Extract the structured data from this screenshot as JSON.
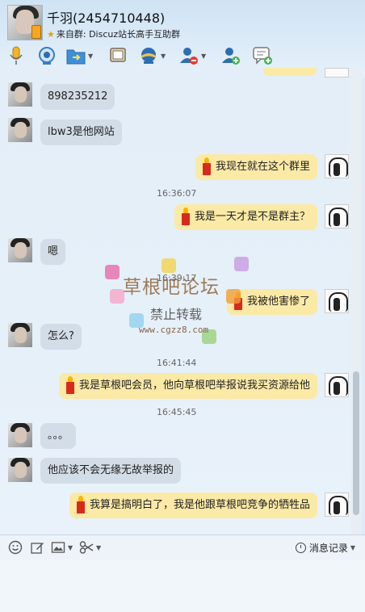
{
  "header": {
    "contact_name": "千羽(2454710448)",
    "source": "来自群: Discuz站长高手互助群"
  },
  "toolbar": {
    "icons": [
      "microphone-icon",
      "video-icon",
      "file-transfer-icon",
      "remote-desktop-icon",
      "app-icon",
      "block-user-icon",
      "add-friend-icon",
      "group-message-icon"
    ]
  },
  "messages": [
    {
      "dir": "in",
      "text": "898235212"
    },
    {
      "dir": "in",
      "text": "lbw3是他网站"
    },
    {
      "dir": "out",
      "text": "我现在就在这个群里"
    },
    {
      "time": "16:36:07"
    },
    {
      "dir": "out",
      "text": "我是一天才是不是群主？"
    },
    {
      "dir": "in",
      "text": "嗯"
    },
    {
      "time": "16:39:17"
    },
    {
      "dir": "out",
      "text": "我被他害惨了"
    },
    {
      "dir": "in",
      "text": "怎么?"
    },
    {
      "time": "16:41:44"
    },
    {
      "dir": "out",
      "text": "我是草根吧会员，他向草根吧举报说我买资源给他"
    },
    {
      "time": "16:45:45"
    },
    {
      "dir": "in",
      "text": "。。。"
    },
    {
      "dir": "in",
      "text": "他应该不会无缘无故举报的"
    },
    {
      "dir": "out",
      "text": "我算是搞明白了，我是他跟草根吧竞争的牺牲品"
    }
  ],
  "watermark": {
    "title": "草根吧论坛",
    "subtitle": "禁止转载",
    "url": "www.cgzz8.com",
    "colors": [
      "#e86aa8",
      "#f7a6c8",
      "#8fd0f0",
      "#f4d34a",
      "#9ad07a",
      "#f29d3c",
      "#c79be0"
    ]
  },
  "input_toolbar": {
    "history_label": "消息记录"
  },
  "colors": {
    "incoming_bubble": "#d3dde7",
    "outgoing_bubble": "#fbe9a6",
    "candle_red": "#d82a1c"
  }
}
